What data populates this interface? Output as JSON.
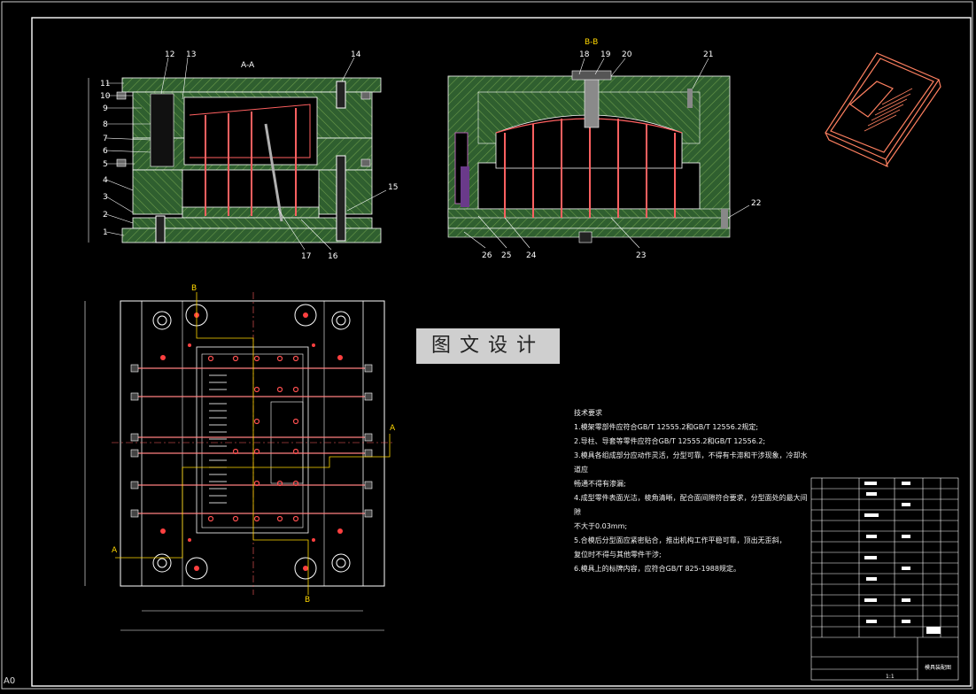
{
  "sheet": {
    "size_label": "A0"
  },
  "watermark": {
    "text": "图文设计"
  },
  "views": {
    "section_aa": {
      "title": "A-A"
    },
    "section_bb": {
      "title": "B-B"
    }
  },
  "part_numbers_left": [
    "1",
    "2",
    "3",
    "4",
    "5",
    "6",
    "7",
    "8",
    "9",
    "10",
    "11",
    "12",
    "13",
    "14",
    "15",
    "16",
    "17"
  ],
  "part_numbers_right": [
    "18",
    "19",
    "20",
    "21",
    "22",
    "23",
    "24",
    "25",
    "26"
  ],
  "section_marks": {
    "b": "B",
    "a": "A"
  },
  "technical_notes": {
    "heading": "技术要求",
    "items": [
      "1.模架零部件应符合GB/T 12555.2和GB/T 12556.2规定;",
      "2.导柱、导套等零件应符合GB/T 12555.2和GB/T 12556.2;",
      "3.模具各组成部分应动作灵活，分型可靠，不得有卡滞和干涉现象，冷却水道应",
      "   畅通不得有渗漏;",
      "4.成型零件表面光洁，棱角清晰，配合面间隙符合要求，分型面处的最大间隙",
      "   不大于0.03mm;",
      "5.合模后分型面应紧密贴合，推出机构工作平稳可靠，顶出无歪斜，",
      "   复位时不得与其他零件干涉;",
      "6.模具上的标牌内容，应符合GB/T 825-1988规定。"
    ]
  },
  "title_block": {
    "drawing_name": "模具装配图",
    "scale": "1:1"
  },
  "colors": {
    "mold_green": "#2f5f2f",
    "hatch": "#6a9a4a",
    "pin": "#ff6060",
    "part": "#ff8060"
  }
}
